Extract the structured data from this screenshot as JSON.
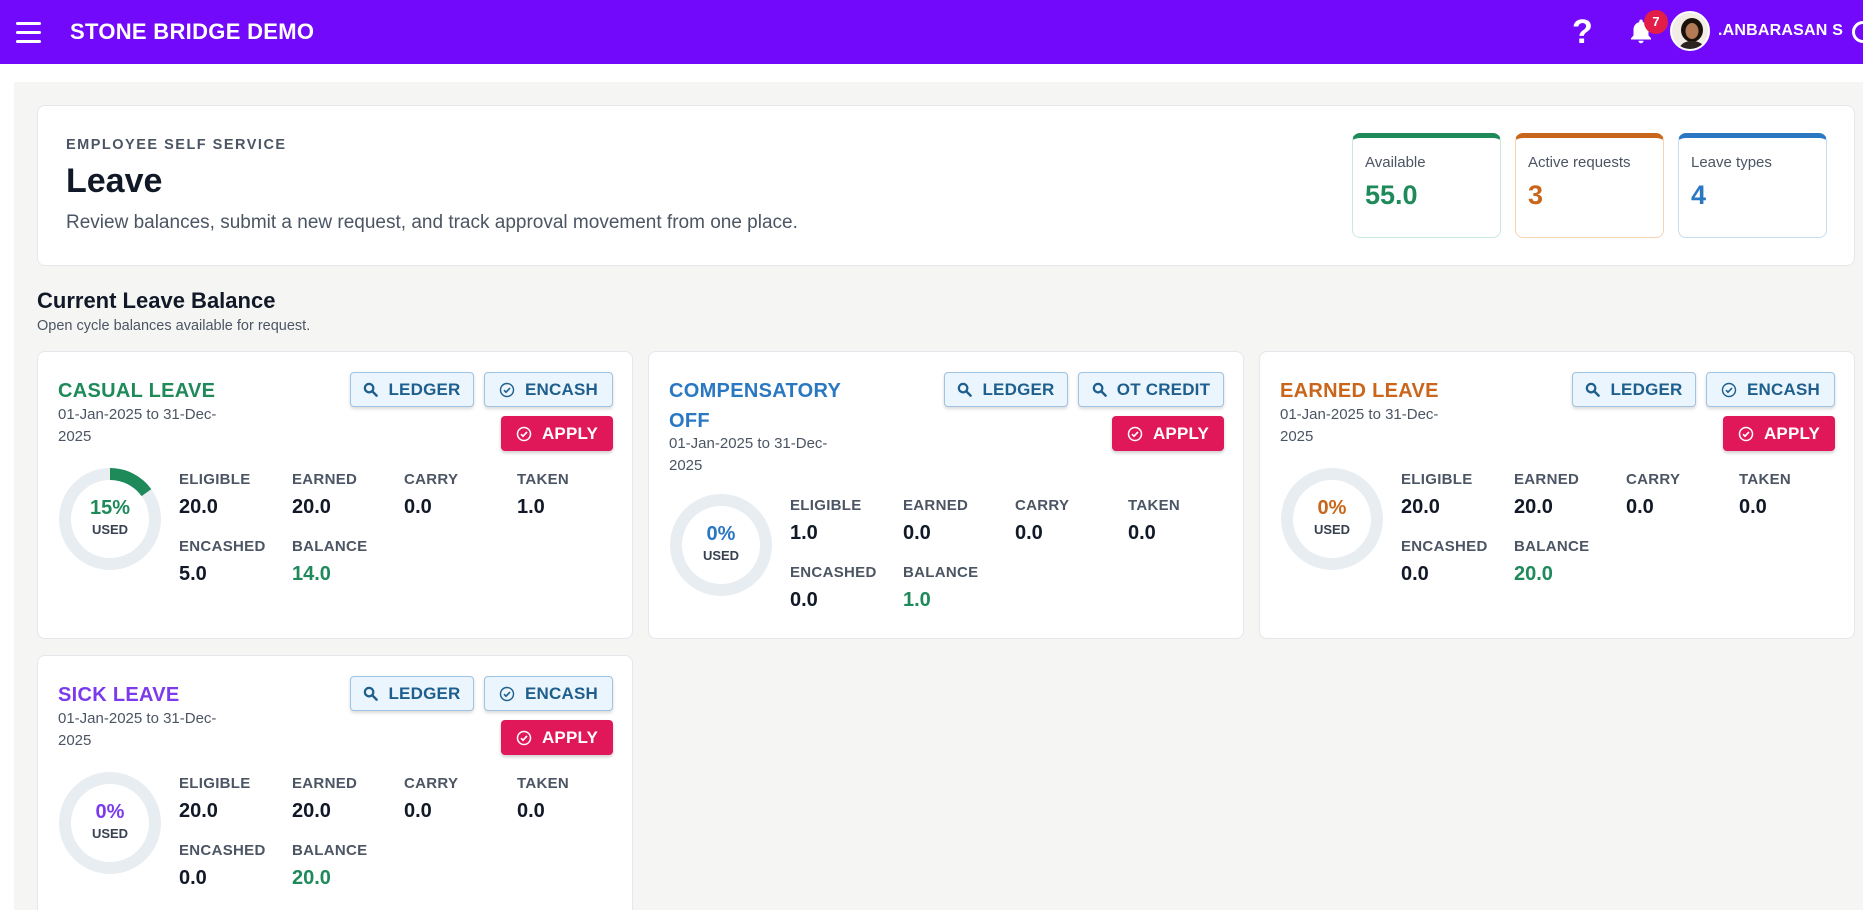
{
  "app": {
    "title": "STONE BRIDGE DEMO",
    "notifications": "7",
    "user_name": ".ANBARASAN S",
    "help": "?"
  },
  "hero": {
    "eyebrow": "EMPLOYEE SELF SERVICE",
    "title": "Leave",
    "subtitle": "Review balances, submit a new request, and track approval movement from one place."
  },
  "stats": [
    {
      "label": "Available",
      "value": "55.0"
    },
    {
      "label": "Active requests",
      "value": "3"
    },
    {
      "label": "Leave types",
      "value": "4"
    }
  ],
  "section": {
    "title": "Current Leave Balance",
    "subtitle": "Open cycle balances available for request."
  },
  "metric_labels": {
    "eligible": "ELIGIBLE",
    "earned": "EARNED",
    "carry": "CARRY",
    "taken": "TAKEN",
    "encashed": "ENCASHED",
    "balance": "BALANCE"
  },
  "buttons": {
    "ledger": "LEDGER",
    "encash": "ENCASH",
    "ot_credit": "OT CREDIT",
    "apply": "APPLY"
  },
  "donut_used_label": "USED",
  "colors": {
    "topbar": "#7209fb",
    "casual": "#1e8a5a",
    "compensatory": "#2a77c2",
    "earned": "#c9661b",
    "sick": "#7c3aed",
    "apply": "#e0185a",
    "balance": "#1e8a5a"
  },
  "cards": [
    {
      "name": "CASUAL LEAVE",
      "period": "01-Jan-2025 to 31-Dec-2025",
      "used_fraction": 0.15,
      "used_pct": "15%",
      "eligible": "20.0",
      "earned": "20.0",
      "carry": "0.0",
      "taken": "1.0",
      "encashed": "5.0",
      "balance": "14.0"
    },
    {
      "name": "COMPENSATORY OFF",
      "period": "01-Jan-2025 to 31-Dec-2025",
      "used_fraction": 0,
      "used_pct": "0%",
      "eligible": "1.0",
      "earned": "0.0",
      "carry": "0.0",
      "taken": "0.0",
      "encashed": "0.0",
      "balance": "1.0"
    },
    {
      "name": "EARNED LEAVE",
      "period": "01-Jan-2025 to 31-Dec-2025",
      "used_fraction": 0,
      "used_pct": "0%",
      "eligible": "20.0",
      "earned": "20.0",
      "carry": "0.0",
      "taken": "0.0",
      "encashed": "0.0",
      "balance": "20.0"
    },
    {
      "name": "SICK LEAVE",
      "period": "01-Jan-2025 to 31-Dec-2025",
      "used_fraction": 0,
      "used_pct": "0%",
      "eligible": "20.0",
      "earned": "20.0",
      "carry": "0.0",
      "taken": "0.0",
      "encashed": "0.0",
      "balance": "20.0"
    }
  ]
}
